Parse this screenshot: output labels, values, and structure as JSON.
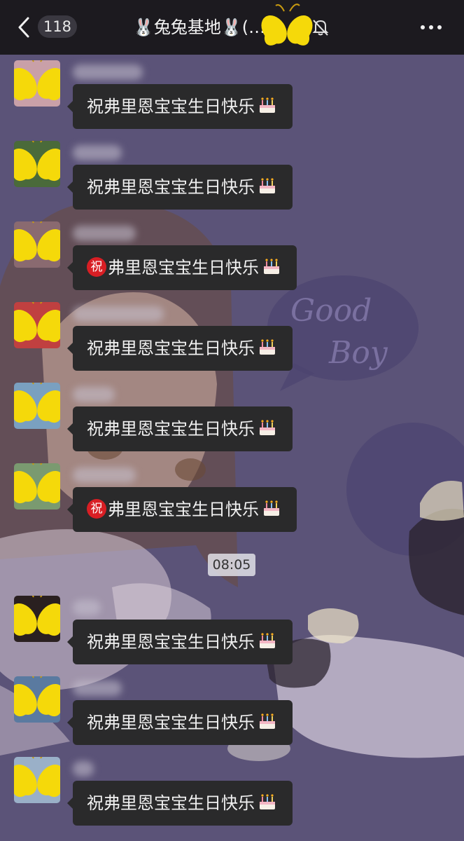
{
  "header": {
    "unread_count": "118",
    "title": "🐰兔兔基地🐰(",
    "title_suffix": "… )"
  },
  "chat": {
    "time_divider": "08:05",
    "messages": [
      {
        "text": "祝弗里恩宝宝生日快乐",
        "style": "plain"
      },
      {
        "text": "祝弗里恩宝宝生日快乐",
        "style": "plain"
      },
      {
        "text": "弗里恩宝宝生日快乐",
        "style": "zhu-emoji"
      },
      {
        "text": "祝弗里恩宝宝生日快乐",
        "style": "plain"
      },
      {
        "text": "祝弗里恩宝宝生日快乐",
        "style": "plain"
      },
      {
        "text": "弗里恩宝宝生日快乐",
        "style": "zhu-emoji"
      },
      {
        "text": "祝弗里恩宝宝生日快乐",
        "style": "plain"
      },
      {
        "text": "祝弗里恩宝宝生日快乐",
        "style": "plain"
      },
      {
        "text": "祝弗里恩宝宝生日快乐",
        "style": "plain"
      }
    ],
    "zhu_emoji_label": "祝"
  },
  "background": {
    "bubble_text_1": "Good",
    "bubble_text_2": "Boy"
  },
  "colors": {
    "header_bg": "#1c1a1f",
    "chat_bg": "#5a5277",
    "bubble_bg": "#2a2a2b",
    "sticker_yellow": "#f5d90a"
  }
}
